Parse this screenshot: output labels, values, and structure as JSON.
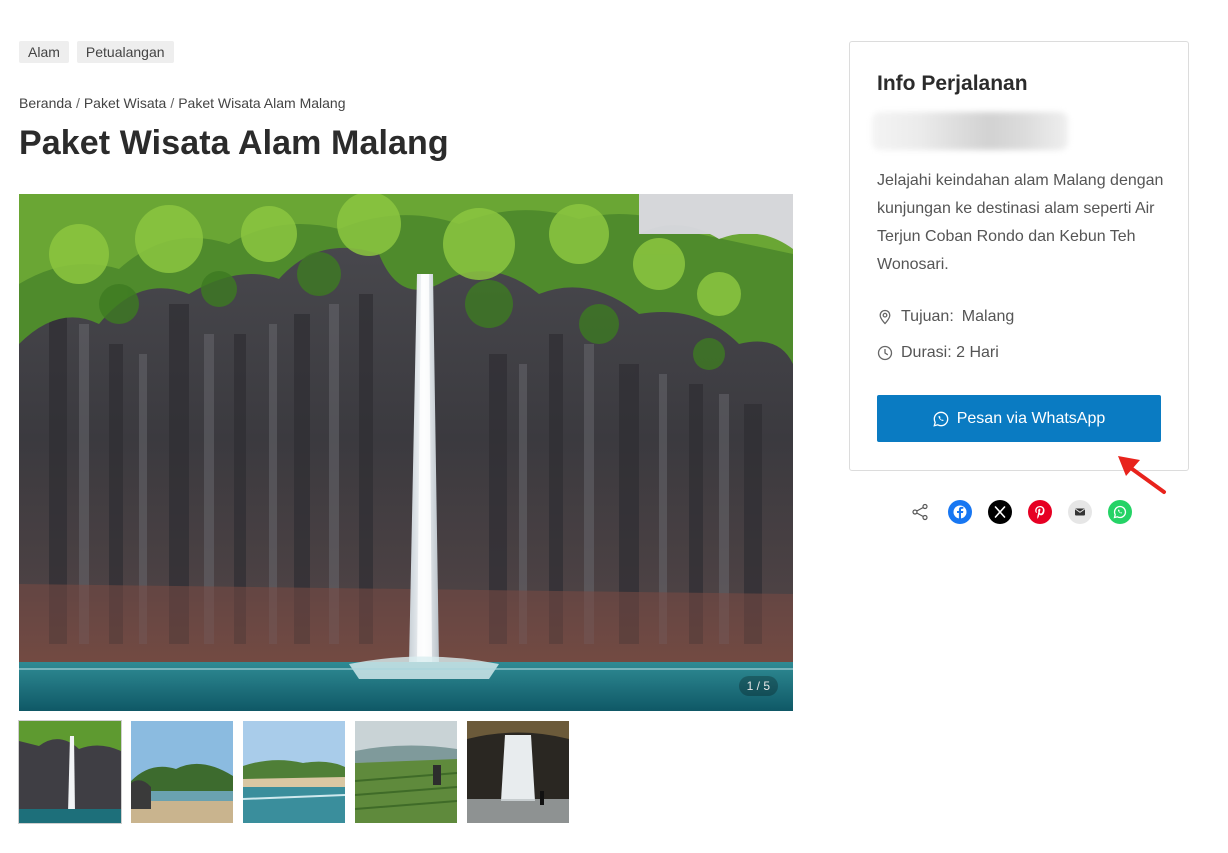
{
  "tags": [
    "Alam",
    "Petualangan"
  ],
  "breadcrumb": {
    "items": [
      "Beranda",
      "Paket Wisata",
      "Paket Wisata Alam Malang"
    ],
    "separator": "/"
  },
  "page_title": "Paket Wisata Alam Malang",
  "gallery": {
    "counter": "1 / 5",
    "thumbnail_count": 5
  },
  "info": {
    "title": "Info Perjalanan",
    "description": "Jelajahi keindahan alam Malang dengan kunjungan ke destinasi alam seperti Air Terjun Coban Rondo dan Kebun Teh Wonosari.",
    "destination_label": "Tujuan:",
    "destination_value": "Malang",
    "duration_label": "Durasi: 2 Hari",
    "whatsapp_button": "Pesan via WhatsApp"
  },
  "share_icons": [
    "share-icon",
    "facebook-icon",
    "x-icon",
    "pinterest-icon",
    "email-icon",
    "whatsapp-icon"
  ],
  "colors": {
    "button": "#0a7bc2",
    "arrow": "#e8231c",
    "facebook": "#1877f2",
    "x": "#000000",
    "pinterest": "#e60023",
    "email": "#e6e6e6",
    "whatsapp": "#25d366"
  }
}
